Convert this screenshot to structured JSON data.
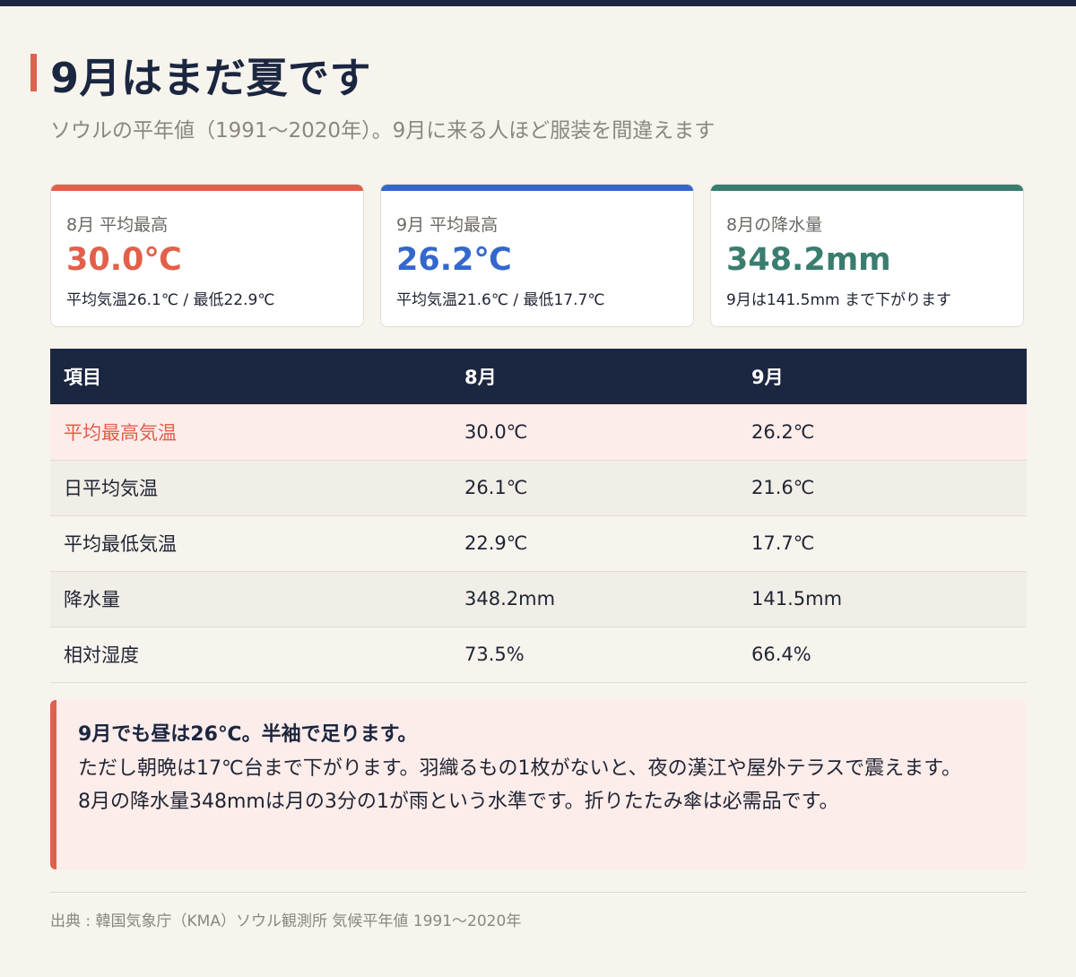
{
  "header": {
    "title": "9月はまだ夏です",
    "subtitle": "ソウルの平年値（1991〜2020年）。9月に来る人ほど服装を間違えます"
  },
  "cards": [
    {
      "label": "8月 平均最高",
      "value": "30.0℃",
      "note": "平均気温26.1℃ / 最低22.9℃",
      "color": "#e2604a"
    },
    {
      "label": "9月 平均最高",
      "value": "26.2℃",
      "note": "平均気温21.6℃ / 最低17.7℃",
      "color": "#3467cc"
    },
    {
      "label": "8月の降水量",
      "value": "348.2mm",
      "note": "9月は141.5mm まで下がります",
      "color": "#3a7d6e"
    }
  ],
  "table": {
    "headers": [
      "項目",
      "8月",
      "9月"
    ],
    "rows": [
      [
        "平均最高気温",
        "30.0℃",
        "26.2℃"
      ],
      [
        "日平均気温",
        "26.1℃",
        "21.6℃"
      ],
      [
        "平均最低気温",
        "22.9℃",
        "17.7℃"
      ],
      [
        "降水量",
        "348.2mm",
        "141.5mm"
      ],
      [
        "相対湿度",
        "73.5%",
        "66.4%"
      ]
    ]
  },
  "callout": {
    "headline": "9月でも昼は26℃。半袖で足ります。",
    "line1": "ただし朝晩は17℃台まで下がります。羽織るもの1枚がないと、夜の漢江や屋外テラスで震えます。",
    "line2": "8月の降水量348mmは月の3分の1が雨という水準です。折りたたみ傘は必需品です。"
  },
  "source": "出典 : 韓国気象庁（KMA）ソウル観測所 気候平年値 1991〜2020年",
  "colors": {
    "navy": "#1b2640",
    "accent_red": "#e2604a",
    "accent_blue": "#3467cc",
    "accent_green": "#3a7d6e",
    "background": "#f7f4ee",
    "highlight_row": "#fcecea"
  }
}
